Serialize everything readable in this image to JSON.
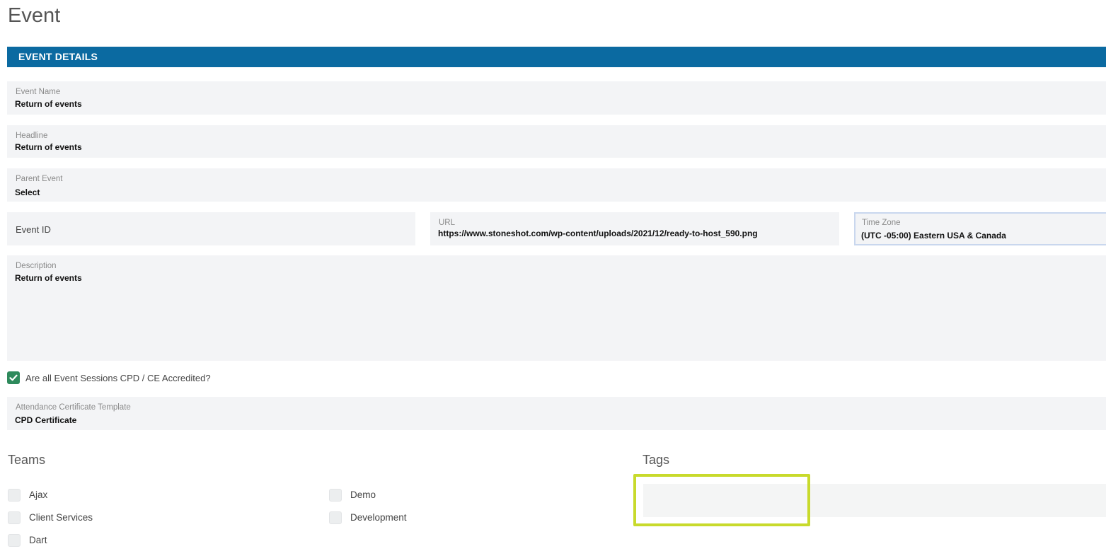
{
  "page": {
    "title": "Event"
  },
  "section": {
    "title": "EVENT DETAILS"
  },
  "fields": {
    "event_name": {
      "label": "Event Name",
      "value": "Return of events"
    },
    "headline": {
      "label": "Headline",
      "value": "Return of events"
    },
    "parent_event": {
      "label": "Parent Event",
      "value": "Select"
    },
    "event_id": {
      "label": "Event ID"
    },
    "url": {
      "label": "URL",
      "value": "https://www.stoneshot.com/wp-content/uploads/2021/12/ready-to-host_590.png"
    },
    "time_zone": {
      "label": "Time Zone",
      "value": "(UTC -05:00) Eastern USA & Canada"
    },
    "description": {
      "label": "Description",
      "value": "Return of events"
    },
    "certificate": {
      "label": "Attendance Certificate Template",
      "value": "CPD Certificate"
    }
  },
  "cpd": {
    "label": "Are all Event Sessions CPD / CE Accredited?",
    "checked": true
  },
  "teams": {
    "heading": "Teams",
    "items": [
      {
        "label": "Ajax",
        "checked": false
      },
      {
        "label": "Client Services",
        "checked": false
      },
      {
        "label": "Dart",
        "checked": false
      },
      {
        "label": "Demo",
        "checked": false
      },
      {
        "label": "Development",
        "checked": false
      }
    ]
  },
  "tags": {
    "heading": "Tags",
    "value": ""
  },
  "colors": {
    "section_bar": "#0b6aa1",
    "checkbox_checked": "#2e8a5c",
    "highlight": "#c8da2c",
    "field_bg": "#f3f4f6"
  }
}
